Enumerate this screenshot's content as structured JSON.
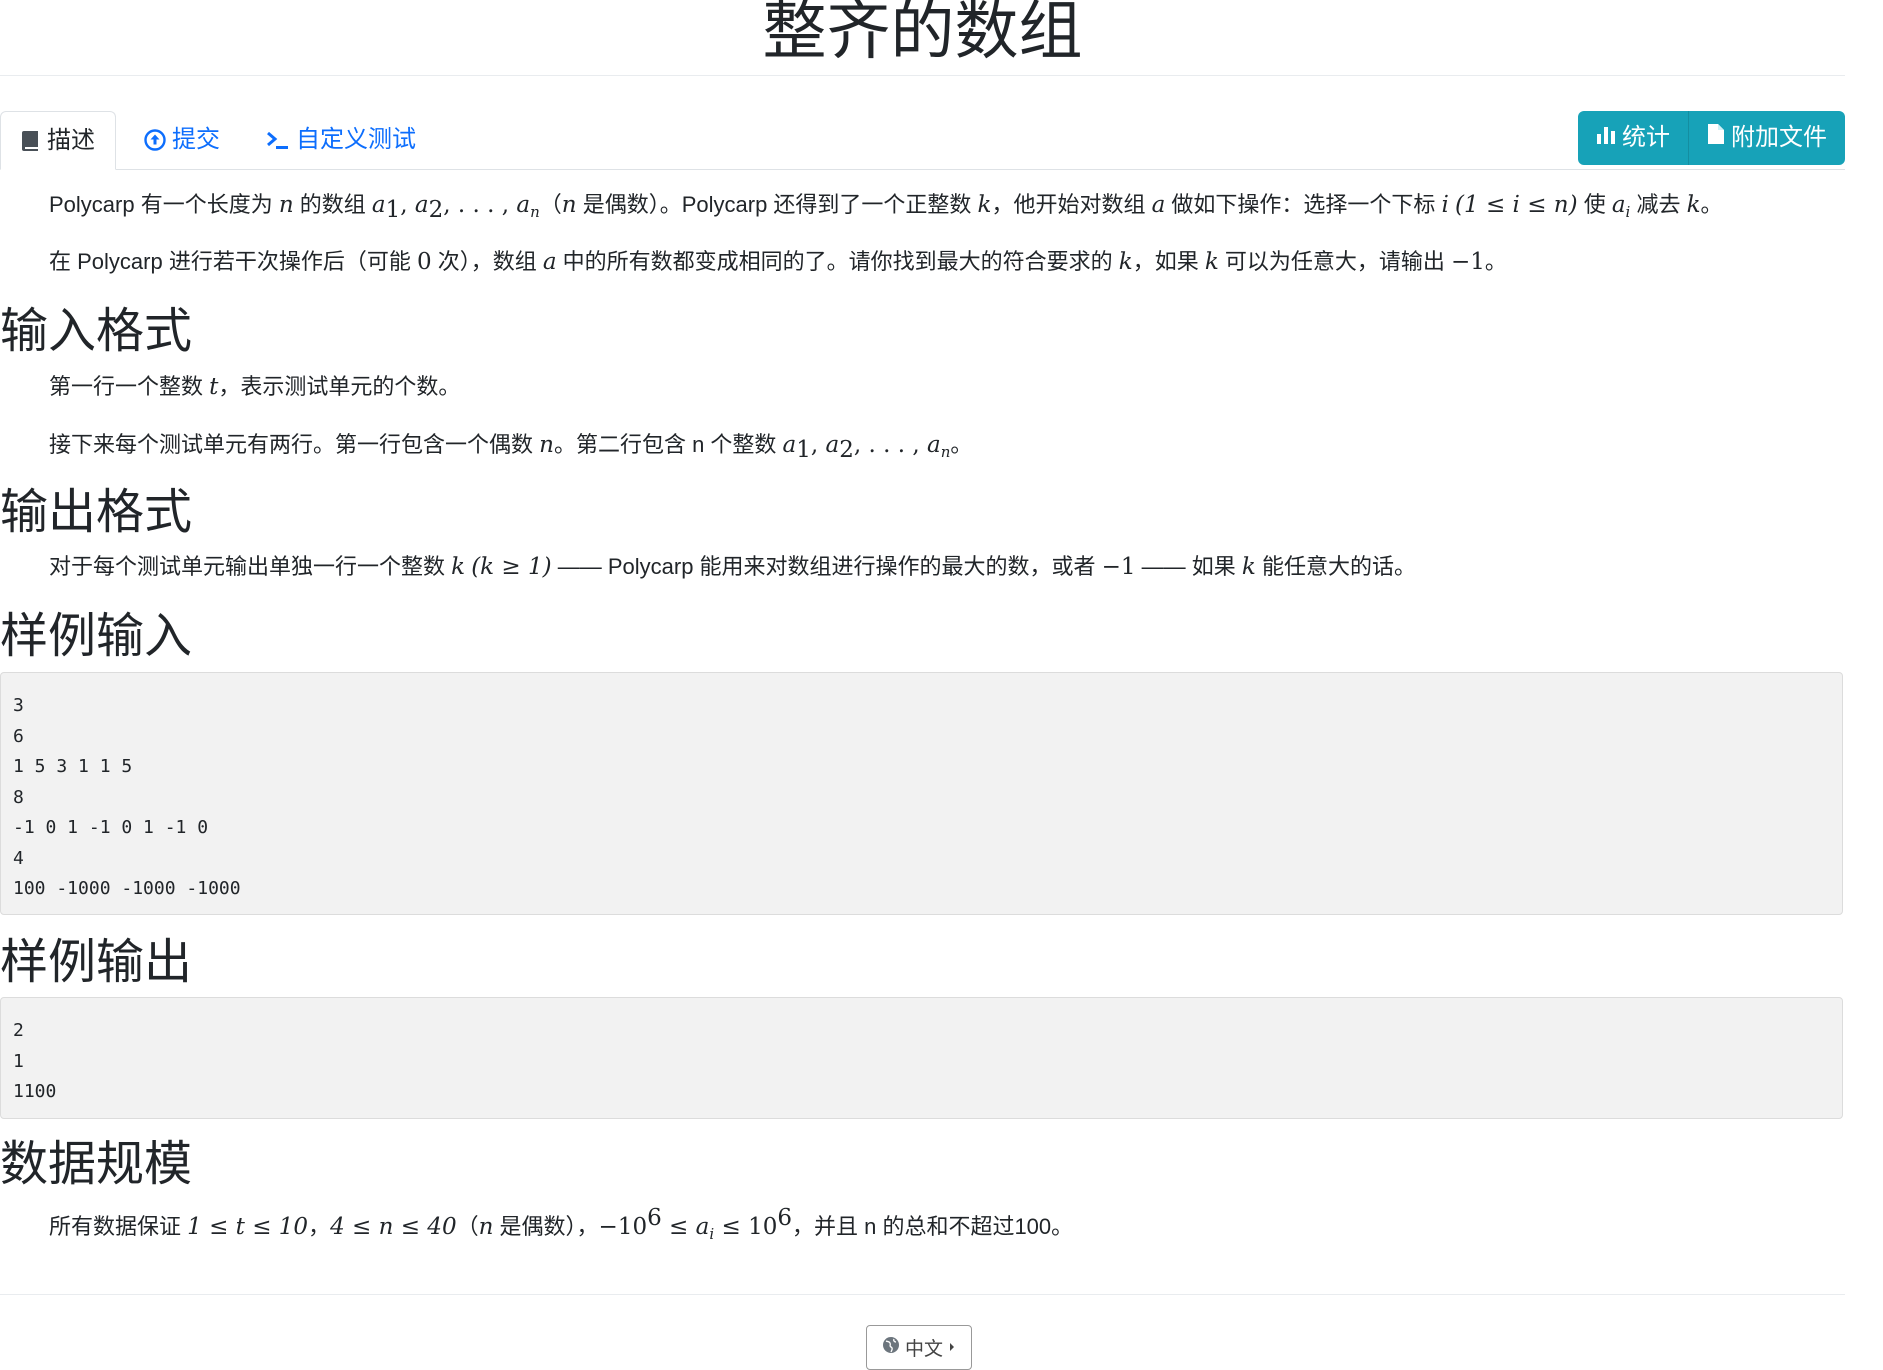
{
  "title": "整齐的数组",
  "tabs": {
    "description": "描述",
    "submit": "提交",
    "custom_test": "自定义测试"
  },
  "buttons": {
    "stats": "统计",
    "attachments": "附加文件"
  },
  "statement": {
    "p1_a": "Polycarp 有一个长度为 ",
    "p1_b": " 的数组 ",
    "p1_c": "（",
    "p1_d": " 是偶数）。Polycarp 还得到了一个正整数 ",
    "p1_e": "，他开始对数组 ",
    "p1_f": " 做如下操作：选择一个下标 ",
    "p1_g": " 使 ",
    "p1_h": " 减去 ",
    "p1_i": "。",
    "p2_a": "在 Polycarp 进行若干次操作后（可能 ",
    "p2_b": " 次），数组 ",
    "p2_c": " 中的所有数都变成相同的了。请你找到最大的符合要求的 ",
    "p2_d": "，如果 ",
    "p2_e": " 可以为任意大，请输出 ",
    "p2_f": "。"
  },
  "input_format": {
    "heading": "输入格式",
    "p1_a": "第一行一个整数 ",
    "p1_b": "，表示测试单元的个数。",
    "p2_a": "接下来每个测试单元有两行。第一行包含一个偶数 ",
    "p2_b": "。第二行包含 n 个整数 ",
    "p2_c": "。"
  },
  "output_format": {
    "heading": "输出格式",
    "p1_a": "对于每个测试单元输出单独一行一个整数 ",
    "p1_b": " —— Polycarp 能用来对数组进行操作的最大的数，或者 ",
    "p1_c": " —— 如果 ",
    "p1_d": " 能任意大的话。"
  },
  "sample_input": {
    "heading": "样例输入",
    "lines": [
      "3",
      "6",
      "1 5 3 1 1 5",
      "8",
      "-1 0 1 -1 0 1 -1 0",
      "4",
      "100 -1000 -1000 -1000"
    ]
  },
  "sample_output": {
    "heading": "样例输出",
    "lines": [
      "2",
      "1",
      "1100"
    ]
  },
  "constraints": {
    "heading": "数据规模",
    "p1_a": "所有数据保证 ",
    "p1_b": "，",
    "p1_c": "（",
    "p1_d": " 是偶数），",
    "p1_e": "，并且 n 的总和不超过100。"
  },
  "math": {
    "n": "n",
    "a": "a",
    "k": "k",
    "i": "i",
    "t": "t",
    "zero": "0",
    "neg1": "−1",
    "seq_a1": "a",
    "seq_sub1": "1",
    "seq_a2": "a",
    "seq_sub2": "2",
    "seq_an": "a",
    "seq_subn": "n",
    "seq_comma": ", ",
    "seq_dots": ", . . . , ",
    "range_i": "(1 ≤ i ≤ n)",
    "ai_base": "a",
    "ai_sub": "i",
    "k_ge1": "(k ≥ 1)",
    "t_range": "1 ≤ t ≤ 10",
    "n_range": "4 ≤ n ≤ 40",
    "ai_range_a": "−10",
    "ai_range_exp": "6",
    "ai_range_b": " ≤ ",
    "ai_range_c": " ≤ 10"
  },
  "footer": {
    "language": "中文"
  },
  "colors": {
    "link": "#0d6efd",
    "info_button": "#17a2b8",
    "code_bg": "#f2f2f2"
  }
}
